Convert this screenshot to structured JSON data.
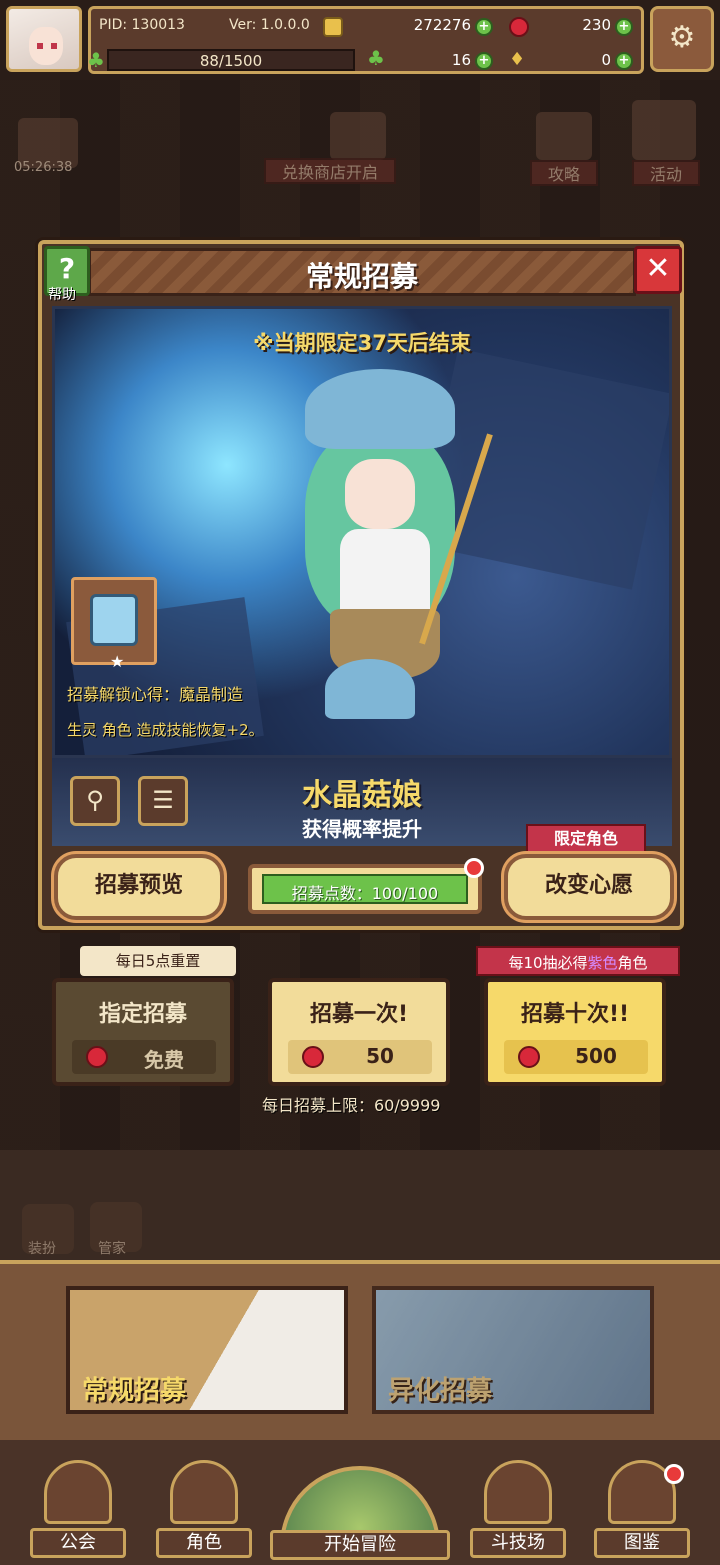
{
  "hud": {
    "pid": "PID: 130013",
    "version": "Ver: 1.0.0.0",
    "gold": "272276",
    "gems": "230",
    "stamina": "88/1500",
    "clover": "16",
    "keys": "0"
  },
  "background": {
    "timer": "05:26:38",
    "exchange_shop": "兑换商店开启",
    "guide": "攻略",
    "event": "活动",
    "dress_up": "装扮",
    "butler": "管家"
  },
  "dialog": {
    "title": "常规招募",
    "help_label": "帮助",
    "limited_time": "※当期限定37天后结束",
    "unlock_title": "招募解锁心得：魔晶制造",
    "unlock_desc": "生灵 角色 造成技能恢复+2。",
    "character_name": "水晶菇娘",
    "rate_up": "获得概率提升",
    "preview_button": "招募预览",
    "points_label": "招募点数：100/100",
    "limited_character_tag": "限定角色",
    "change_wish_button": "改变心愿"
  },
  "recruit": {
    "daily_reset_tag": "每日5点重置",
    "ten_tag_prefix": "每10抽必得",
    "ten_tag_purple": "紫色",
    "ten_tag_suffix": "角色",
    "designated": {
      "label": "指定招募",
      "cost": "免费"
    },
    "once": {
      "label": "招募一次!",
      "cost": "50"
    },
    "ten": {
      "label": "招募十次!!",
      "cost": "500"
    },
    "daily_limit": "每日招募上限：60/9999"
  },
  "tabs": {
    "regular": "常规招募",
    "alien": "异化招募"
  },
  "nav": {
    "guild": "公会",
    "character": "角色",
    "adventure": "开始冒险",
    "arena": "斗技场",
    "codex": "图鉴"
  }
}
